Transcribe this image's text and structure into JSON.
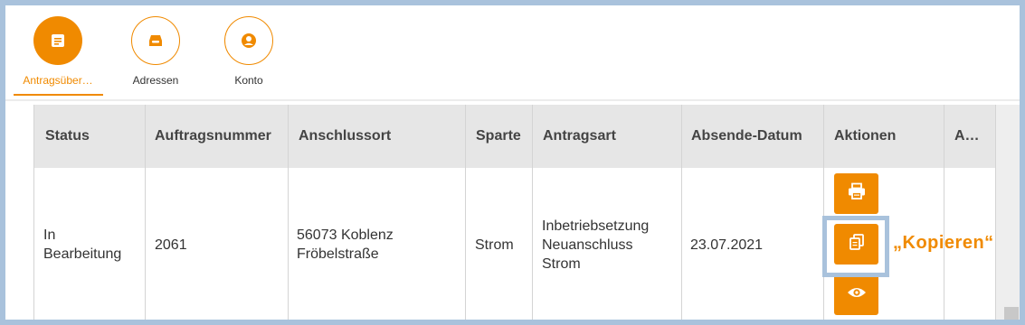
{
  "nav": {
    "items": [
      {
        "label": "Antragsüber…",
        "icon": "document-list-icon",
        "active": true
      },
      {
        "label": "Adressen",
        "icon": "inbox-tray-icon",
        "active": false
      },
      {
        "label": "Konto",
        "icon": "user-account-icon",
        "active": false
      }
    ]
  },
  "table": {
    "headers": [
      "Status",
      "Auftragsnummer",
      "Anschlussort",
      "Sparte",
      "Antragsart",
      "Absende-Datum",
      "Aktionen",
      "A…"
    ],
    "rows": [
      {
        "status": [
          "In",
          "Bearbeitung"
        ],
        "auftragsnummer": "2061",
        "anschlussort": [
          "56073 Koblenz",
          "Fröbelstraße"
        ],
        "sparte": "Strom",
        "antragsart": [
          "Inbetriebsetzung",
          "Neuanschluss",
          "Strom"
        ],
        "absende_datum": "23.07.2021",
        "actions": [
          "printer-icon",
          "copy-icon",
          "eye-icon"
        ]
      }
    ]
  },
  "callout": "„Kopieren“",
  "colors": {
    "accent": "#f08a00",
    "frame": "#a9c2dc",
    "header_bg": "#e6e6e6"
  }
}
